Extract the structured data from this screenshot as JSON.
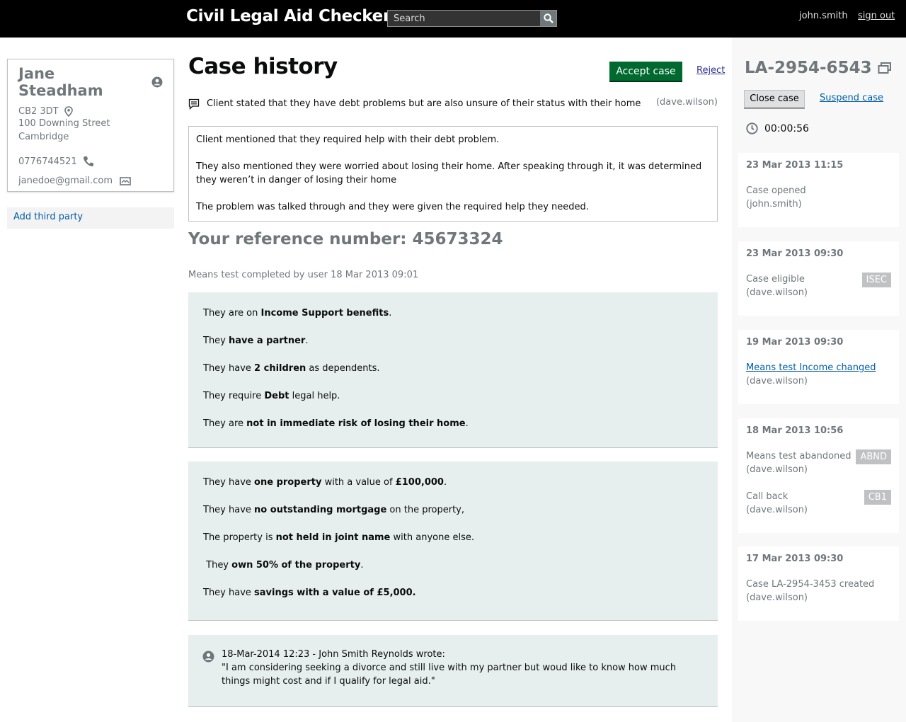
{
  "header": {
    "app_title": "Civil Legal Aid Checker",
    "search_placeholder": "Search",
    "username": "john.smith",
    "sign_out": "sign out"
  },
  "client": {
    "name": "Jane Steadham",
    "postcode": "CB2 3DT",
    "street": "100 Downing Street",
    "city": "Cambridge",
    "phone": "0776744521",
    "email": "janedoe@gmail.com",
    "add_third_party": "Add third party"
  },
  "main": {
    "title": "Case history",
    "accept_label": "Accept case",
    "reject_label": "Reject",
    "comment": {
      "text": "Client stated that they have debt problems but are also unsure of their status with their home",
      "author": "(dave.wilson)"
    },
    "notes": [
      "Client mentioned that they required help with their debt problem.",
      "They also mentioned they were worried about losing their home. After speaking through it, it was determined they weren’t in danger of losing their home",
      "The problem was talked through and they were given the required help they needed."
    ],
    "reference_heading": "Your reference number: 45673324",
    "means_note": "Means test completed by user 18 Mar 2013 09:01",
    "panel_a": [
      {
        "pre": "They are on ",
        "bold": "Income Support benefits",
        "post": "."
      },
      {
        "pre": "They ",
        "bold": "have a partner",
        "post": "."
      },
      {
        "pre": "They have ",
        "bold": "2 children",
        "post": " as dependents."
      },
      {
        "pre": "They require ",
        "bold": "Debt",
        "post": " legal help."
      },
      {
        "pre": "They are ",
        "bold": "not in immediate risk of losing their home",
        "post": "."
      }
    ],
    "panel_b": {
      "line1": {
        "a": "They have ",
        "b": "one property",
        "c": " with a value of ",
        "d": "£100,000",
        "e": "."
      },
      "line2": {
        "pre": "They have ",
        "bold": "no outstanding mortgage",
        "post": " on the property,"
      },
      "line3": {
        "pre": "The property is ",
        "bold": "not held in joint name",
        "post": " with anyone else."
      },
      "line4": {
        "pre": " They ",
        "bold": "own 50% of the property",
        "post": "."
      },
      "line5": {
        "pre": "They have ",
        "bold": "savings with a value of £5,000.",
        "post": ""
      }
    },
    "message": {
      "header": "18-Mar-2014 12:23 - John Smith Reynolds wrote:",
      "body": "\"I am considering seeking a divorce and still live with my partner but woud like to know how much things might cost and if I qualify for legal aid.\""
    }
  },
  "case": {
    "reference": "LA-2954-6543",
    "close_label": "Close case",
    "suspend_label": "Suspend case",
    "timer": "00:00:56",
    "events": [
      {
        "date": "23 Mar 2013 11:15",
        "entries": [
          {
            "text": "Case opened",
            "user": "(john.smith)",
            "tag": ""
          }
        ]
      },
      {
        "date": "23 Mar 2013 09:30",
        "entries": [
          {
            "text": "Case eligible",
            "user": "(dave.wilson)",
            "tag": "ISEC"
          }
        ]
      },
      {
        "date": "19 Mar 2013 09:30",
        "entries": [
          {
            "text": "Means test Income changed",
            "user": "(dave.wilson)",
            "tag": ""
          }
        ]
      },
      {
        "date": "18 Mar 2013 10:56",
        "entries": [
          {
            "text": "Means test abandoned",
            "user": "(dave.wilson)",
            "tag": "ABND"
          },
          {
            "text": "Call back",
            "user": "(dave.wilson)",
            "tag": "CB1"
          }
        ]
      },
      {
        "date": "17 Mar 2013 09:30",
        "entries": [
          {
            "text": "Case LA-2954-3453 created",
            "user": "(dave.wilson)",
            "tag": ""
          }
        ]
      }
    ]
  },
  "colors": {
    "header_bg": "#000000",
    "accept_green": "#00692f",
    "link_blue": "#005ea5",
    "panel_bg": "#e6efee",
    "muted_grey": "#6f777b"
  },
  "icons": [
    "search-icon",
    "user-icon",
    "location-pin-icon",
    "phone-icon",
    "mail-icon",
    "comment-icon",
    "copy-icon",
    "clock-icon",
    "avatar-icon"
  ]
}
